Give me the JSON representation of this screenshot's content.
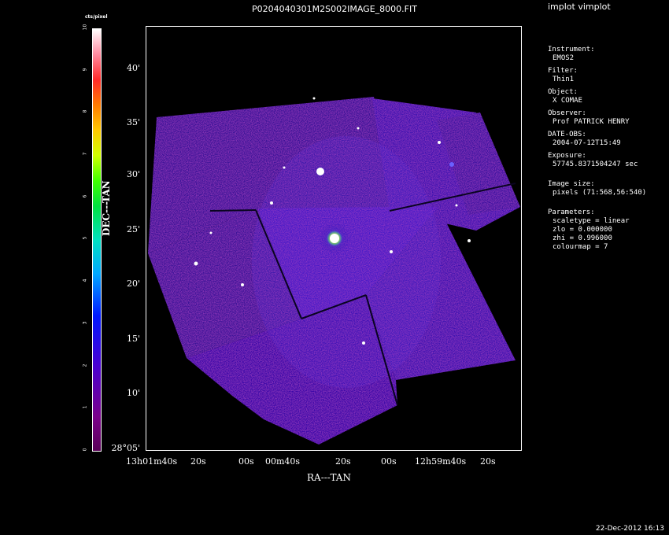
{
  "header": {
    "title": "P0204040301M2S002IMAGE_8000.FIT",
    "program": "implot vimplot"
  },
  "colorbar": {
    "title": "cts/pixel",
    "ticks": [
      "0",
      "1",
      "2",
      "3",
      "4",
      "5",
      "6",
      "7",
      "8",
      "9",
      "10"
    ]
  },
  "axes": {
    "ylabel": "DEC---TAN",
    "xlabel": "RA---TAN",
    "yticks": [
      "40'",
      "35'",
      "30'",
      "25'",
      "20'",
      "15'",
      "10'",
      "28°05'"
    ],
    "xticks": [
      "13h01m40s",
      "20s",
      "00s",
      "00m40s",
      "20s",
      "00s",
      "12h59m40s",
      "20s"
    ]
  },
  "info": {
    "instrument_label": "Instrument:",
    "instrument": "EMOS2",
    "filter_label": "Filter:",
    "filter": "Thin1",
    "object_label": "Object:",
    "object": "X COMAE",
    "observer_label": "Observer:",
    "observer": "Prof PATRICK HENRY",
    "date_label": "DATE-OBS:",
    "date": "2004-07-12T15:49",
    "exposure_label": "Exposure:",
    "exposure": "57745.8371504247 sec",
    "imagesize_label": "Image size:",
    "imagesize": "pixels (71:568,56:540)",
    "params_label": "Parameters:",
    "scaletype": "scaletype = linear",
    "zlo": "zlo = 0.000000",
    "zhi": "zhi = 0.996000",
    "colourmap": "colourmap =   7"
  },
  "footer": {
    "timestamp": "22-Dec-2012 16:13"
  },
  "colors": {
    "background": "#000000",
    "field": "#3a10a8",
    "frame": "#ffffff"
  }
}
